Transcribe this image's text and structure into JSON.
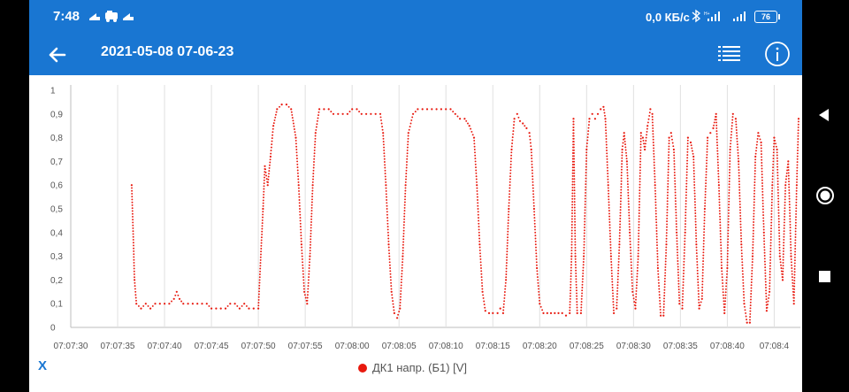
{
  "status_bar": {
    "time": "7:48",
    "speed": "0,0 КБ/с",
    "battery": "76",
    "icons": [
      "notification-icon",
      "car-icon",
      "notification-icon",
      "bluetooth-icon",
      "signal-icon",
      "signal-icon",
      "battery-icon"
    ]
  },
  "app_bar": {
    "title": "2021-05-08 07-06-23"
  },
  "footer": {
    "x_label": "X",
    "legend_label": "ДК1 напр. (Б1) [V]"
  },
  "colors": {
    "primary": "#1976d2",
    "series": "#e8190e"
  },
  "chart_data": {
    "type": "scatter",
    "title": "",
    "xlabel": "",
    "ylabel": "",
    "x_ticks": [
      "07:07:30",
      "07:07:35",
      "07:07:40",
      "07:07:45",
      "07:07:50",
      "07:07:55",
      "07:08:00",
      "07:08:05",
      "07:08:10",
      "07:08:15",
      "07:08:20",
      "07:08:25",
      "07:08:30",
      "07:08:35",
      "07:08:40",
      "07:08:4"
    ],
    "y_ticks": [
      "0",
      "0,1",
      "0,2",
      "0,3",
      "0,4",
      "0,5",
      "0,6",
      "0,7",
      "0,8",
      "0,9",
      "1"
    ],
    "ylim": [
      0,
      1
    ],
    "xlim_seconds": [
      0,
      77.6
    ],
    "x_unit_note": "seconds after 07:07:30",
    "grid": true,
    "series": [
      {
        "name": "ДК1 напр. (Б1) [V]",
        "points": [
          [
            6.5,
            0.6
          ],
          [
            6.8,
            0.2
          ],
          [
            7.0,
            0.1
          ],
          [
            7.5,
            0.08
          ],
          [
            8.0,
            0.1
          ],
          [
            8.5,
            0.08
          ],
          [
            9.0,
            0.1
          ],
          [
            9.5,
            0.1
          ],
          [
            10.0,
            0.1
          ],
          [
            10.5,
            0.1
          ],
          [
            11.0,
            0.12
          ],
          [
            11.3,
            0.15
          ],
          [
            11.6,
            0.12
          ],
          [
            12.0,
            0.1
          ],
          [
            12.5,
            0.1
          ],
          [
            13.0,
            0.1
          ],
          [
            13.5,
            0.1
          ],
          [
            14.0,
            0.1
          ],
          [
            14.5,
            0.1
          ],
          [
            15.0,
            0.08
          ],
          [
            15.5,
            0.08
          ],
          [
            16.0,
            0.08
          ],
          [
            16.5,
            0.08
          ],
          [
            17.0,
            0.1
          ],
          [
            17.5,
            0.1
          ],
          [
            18.0,
            0.08
          ],
          [
            18.5,
            0.1
          ],
          [
            19.0,
            0.08
          ],
          [
            19.5,
            0.08
          ],
          [
            20.0,
            0.08
          ],
          [
            20.5,
            0.5
          ],
          [
            20.7,
            0.68
          ],
          [
            21.0,
            0.6
          ],
          [
            21.3,
            0.72
          ],
          [
            21.6,
            0.85
          ],
          [
            22.0,
            0.92
          ],
          [
            22.5,
            0.94
          ],
          [
            23.0,
            0.94
          ],
          [
            23.5,
            0.92
          ],
          [
            24.0,
            0.8
          ],
          [
            24.3,
            0.6
          ],
          [
            24.6,
            0.35
          ],
          [
            24.9,
            0.15
          ],
          [
            25.2,
            0.1
          ],
          [
            25.5,
            0.3
          ],
          [
            25.8,
            0.6
          ],
          [
            26.1,
            0.82
          ],
          [
            26.5,
            0.92
          ],
          [
            27.0,
            0.92
          ],
          [
            27.5,
            0.92
          ],
          [
            28.0,
            0.9
          ],
          [
            28.5,
            0.9
          ],
          [
            29.0,
            0.9
          ],
          [
            29.5,
            0.9
          ],
          [
            30.0,
            0.92
          ],
          [
            30.5,
            0.92
          ],
          [
            31.0,
            0.9
          ],
          [
            31.5,
            0.9
          ],
          [
            32.0,
            0.9
          ],
          [
            32.5,
            0.9
          ],
          [
            33.0,
            0.9
          ],
          [
            33.3,
            0.82
          ],
          [
            33.6,
            0.6
          ],
          [
            33.9,
            0.35
          ],
          [
            34.2,
            0.15
          ],
          [
            34.5,
            0.06
          ],
          [
            34.8,
            0.04
          ],
          [
            35.1,
            0.08
          ],
          [
            35.4,
            0.3
          ],
          [
            35.7,
            0.6
          ],
          [
            36.0,
            0.82
          ],
          [
            36.5,
            0.9
          ],
          [
            37.0,
            0.92
          ],
          [
            37.5,
            0.92
          ],
          [
            38.0,
            0.92
          ],
          [
            38.5,
            0.92
          ],
          [
            39.0,
            0.92
          ],
          [
            39.5,
            0.92
          ],
          [
            40.0,
            0.92
          ],
          [
            40.5,
            0.92
          ],
          [
            41.0,
            0.9
          ],
          [
            41.5,
            0.88
          ],
          [
            42.0,
            0.88
          ],
          [
            42.5,
            0.85
          ],
          [
            43.0,
            0.8
          ],
          [
            43.3,
            0.6
          ],
          [
            43.6,
            0.35
          ],
          [
            43.9,
            0.15
          ],
          [
            44.2,
            0.07
          ],
          [
            44.6,
            0.06
          ],
          [
            45.0,
            0.06
          ],
          [
            45.5,
            0.06
          ],
          [
            45.8,
            0.08
          ],
          [
            46.1,
            0.06
          ],
          [
            46.4,
            0.2
          ],
          [
            46.7,
            0.5
          ],
          [
            47.0,
            0.75
          ],
          [
            47.3,
            0.88
          ],
          [
            47.6,
            0.9
          ],
          [
            47.9,
            0.87
          ],
          [
            48.2,
            0.86
          ],
          [
            48.6,
            0.84
          ],
          [
            48.9,
            0.82
          ],
          [
            49.1,
            0.75
          ],
          [
            49.4,
            0.5
          ],
          [
            49.7,
            0.25
          ],
          [
            50.0,
            0.1
          ],
          [
            50.4,
            0.06
          ],
          [
            50.8,
            0.06
          ],
          [
            51.2,
            0.06
          ],
          [
            51.6,
            0.06
          ],
          [
            52.0,
            0.06
          ],
          [
            52.4,
            0.06
          ],
          [
            52.8,
            0.05
          ],
          [
            53.2,
            0.06
          ],
          [
            53.4,
            0.3
          ],
          [
            53.6,
            0.88
          ],
          [
            53.8,
            0.3
          ],
          [
            54.0,
            0.06
          ],
          [
            54.4,
            0.06
          ],
          [
            54.7,
            0.3
          ],
          [
            55.0,
            0.75
          ],
          [
            55.3,
            0.88
          ],
          [
            55.6,
            0.9
          ],
          [
            55.9,
            0.88
          ],
          [
            56.2,
            0.9
          ],
          [
            56.5,
            0.92
          ],
          [
            56.8,
            0.93
          ],
          [
            57.0,
            0.88
          ],
          [
            57.3,
            0.6
          ],
          [
            57.6,
            0.3
          ],
          [
            57.9,
            0.06
          ],
          [
            58.2,
            0.08
          ],
          [
            58.5,
            0.35
          ],
          [
            58.8,
            0.75
          ],
          [
            59.0,
            0.82
          ],
          [
            59.3,
            0.7
          ],
          [
            59.6,
            0.4
          ],
          [
            59.9,
            0.15
          ],
          [
            60.2,
            0.08
          ],
          [
            60.5,
            0.3
          ],
          [
            60.8,
            0.82
          ],
          [
            61.0,
            0.8
          ],
          [
            61.2,
            0.75
          ],
          [
            61.5,
            0.85
          ],
          [
            61.8,
            0.92
          ],
          [
            62.0,
            0.9
          ],
          [
            62.3,
            0.6
          ],
          [
            62.6,
            0.25
          ],
          [
            62.9,
            0.05
          ],
          [
            63.2,
            0.05
          ],
          [
            63.5,
            0.35
          ],
          [
            63.8,
            0.8
          ],
          [
            64.0,
            0.82
          ],
          [
            64.3,
            0.75
          ],
          [
            64.6,
            0.4
          ],
          [
            64.9,
            0.1
          ],
          [
            65.2,
            0.08
          ],
          [
            65.5,
            0.4
          ],
          [
            65.8,
            0.8
          ],
          [
            66.1,
            0.78
          ],
          [
            66.4,
            0.72
          ],
          [
            66.7,
            0.35
          ],
          [
            67.0,
            0.08
          ],
          [
            67.3,
            0.12
          ],
          [
            67.6,
            0.5
          ],
          [
            67.9,
            0.8
          ],
          [
            68.2,
            0.82
          ],
          [
            68.5,
            0.84
          ],
          [
            68.8,
            0.9
          ],
          [
            69.1,
            0.6
          ],
          [
            69.4,
            0.25
          ],
          [
            69.7,
            0.06
          ],
          [
            70.0,
            0.25
          ],
          [
            70.3,
            0.75
          ],
          [
            70.6,
            0.9
          ],
          [
            70.9,
            0.88
          ],
          [
            71.2,
            0.7
          ],
          [
            71.5,
            0.35
          ],
          [
            71.8,
            0.1
          ],
          [
            72.1,
            0.02
          ],
          [
            72.4,
            0.02
          ],
          [
            72.7,
            0.3
          ],
          [
            73.0,
            0.72
          ],
          [
            73.3,
            0.82
          ],
          [
            73.6,
            0.78
          ],
          [
            73.9,
            0.4
          ],
          [
            74.2,
            0.07
          ],
          [
            74.5,
            0.15
          ],
          [
            74.8,
            0.6
          ],
          [
            75.0,
            0.8
          ],
          [
            75.3,
            0.75
          ],
          [
            75.6,
            0.3
          ],
          [
            75.9,
            0.2
          ],
          [
            76.2,
            0.6
          ],
          [
            76.5,
            0.7
          ],
          [
            76.8,
            0.3
          ],
          [
            77.1,
            0.1
          ],
          [
            77.4,
            0.6
          ],
          [
            77.6,
            0.88
          ]
        ]
      }
    ]
  }
}
